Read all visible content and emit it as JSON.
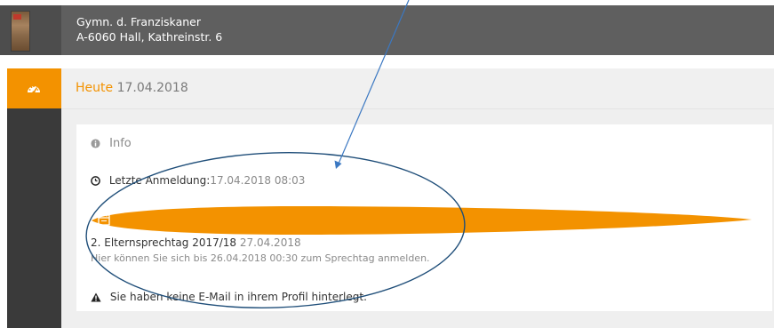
{
  "header": {
    "school_name": "Gymn. d. Franziskaner",
    "school_address": "A-6060 Hall, Kathreinstr. 6"
  },
  "today": {
    "label": "Heute",
    "date": "17.04.2018"
  },
  "info": {
    "title": "Info",
    "last_login_label": "Letzte Anmeldung:",
    "last_login_value": "17.04.2018 08:03",
    "event_title": "2. Elternsprechtag 2017/18",
    "event_date": "27.04.2018",
    "event_desc": "Hier können Sie sich bis 26.04.2018 00:30 zum Sprechtag anmelden.",
    "email_warning": "Sie haben keine E-Mail in ihrem Profil hinterlegt."
  },
  "colors": {
    "accent": "#f39200",
    "header_bg": "#5f5f5f",
    "sidebar_bg": "#3a3a3a",
    "annotation": "#1f4e79"
  },
  "icons": [
    "dashboard-icon",
    "info-icon",
    "clock-icon",
    "warning-icon",
    "calendar-icon"
  ]
}
